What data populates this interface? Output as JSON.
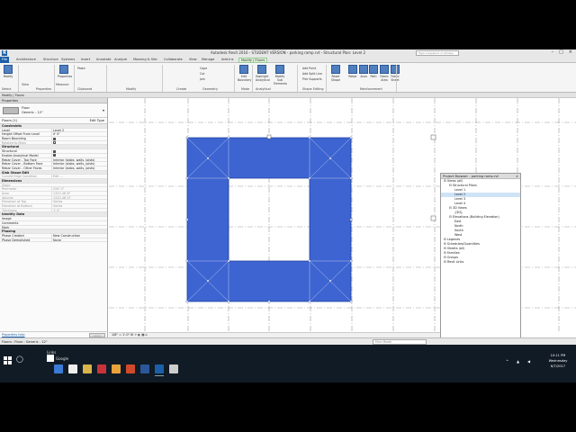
{
  "app": {
    "title": "Autodesk Revit 2016 - STUDENT VERSION - parking ramp.rvt - Structural Plan: Level 2",
    "search_placeholder": "Type a keyword or phrase",
    "logo": "R"
  },
  "tabs": [
    "File",
    "Architecture",
    "Structure",
    "Systems",
    "Insert",
    "Annotate",
    "Analyze",
    "Massing & Site",
    "Collaborate",
    "View",
    "Manage",
    "Add-Ins",
    "Modify | Floors"
  ],
  "ribbon": {
    "buttons": [
      {
        "label": "Modify",
        "icon": "cursor-icon"
      },
      {
        "label": "Properties",
        "icon": "properties-icon"
      },
      {
        "label": "Edit Boundary",
        "icon": "edit-boundary-icon"
      },
      {
        "label": "Highlight Analytical",
        "icon": "highlight-analytical-icon"
      },
      {
        "label": "Modify Sub Elements",
        "icon": "modify-sub-elements-icon"
      },
      {
        "label": "Reset Shape",
        "icon": "reset-shape-icon"
      },
      {
        "label": "Rebar",
        "icon": "rebar-icon"
      },
      {
        "label": "Area",
        "icon": "area-icon"
      },
      {
        "label": "Path",
        "icon": "path-icon"
      },
      {
        "label": "Fabric Area",
        "icon": "fabric-area-icon"
      },
      {
        "label": "Fabric Sheet",
        "icon": "fabric-sheet-icon"
      }
    ],
    "small": [
      "Cope",
      "Cut",
      "Join",
      "Paste",
      "Add Point",
      "Add Split Line",
      "Pick Supports"
    ],
    "groups": [
      "Select",
      "Properties",
      "Clipboard",
      "Geometry",
      "Modify",
      "View",
      "Measure",
      "Create",
      "Mode",
      "Analytical",
      "Shape Editing",
      "Reinforcement"
    ]
  },
  "context_bar": "Modify | Floors",
  "properties": {
    "header": "Properties",
    "type_family": "Floor",
    "type_name": "Generic - 12\"",
    "instance_filter": "Floors (1)",
    "edit_type": "Edit Type",
    "rows": [
      {
        "k": "Constraints",
        "v": "",
        "kind": "sec"
      },
      {
        "k": "Level",
        "v": "Level 2"
      },
      {
        "k": "Height Offset From Level",
        "v": "0' 0\""
      },
      {
        "k": "Room Bounding",
        "v": "",
        "check": true
      },
      {
        "k": "Related to Mass",
        "v": "",
        "check": false,
        "gray": true
      },
      {
        "k": "Structural",
        "v": "",
        "kind": "sec"
      },
      {
        "k": "Structural",
        "v": "",
        "check": true
      },
      {
        "k": "Enable Analytical Model",
        "v": "",
        "check": true
      },
      {
        "k": "Rebar Cover - Top Face",
        "v": "Interior (slabs, walls, joists)"
      },
      {
        "k": "Rebar Cover - Bottom Face",
        "v": "Interior (slabs, walls, joists)"
      },
      {
        "k": "Rebar Cover - Other Faces",
        "v": "Interior (slabs, walls, joists)"
      },
      {
        "k": "Slab Shape Edit",
        "v": "",
        "kind": "sec"
      },
      {
        "k": "Curved Edge Condition",
        "v": "Edit ...",
        "gray": true
      },
      {
        "k": "Dimensions",
        "v": "",
        "kind": "sec"
      },
      {
        "k": "Slope",
        "v": "",
        "gray": true
      },
      {
        "k": "Perimeter",
        "v": "256' 0\"",
        "gray": true
      },
      {
        "k": "Area",
        "v": "1320.48 SF",
        "gray": true
      },
      {
        "k": "Volume",
        "v": "1320.48 CF",
        "gray": true
      },
      {
        "k": "Elevation at Top",
        "v": "Varies",
        "gray": true
      },
      {
        "k": "Elevation at Bottom",
        "v": "Varies",
        "gray": true
      },
      {
        "k": "Thickness",
        "v": "1' 0\"",
        "gray": true
      },
      {
        "k": "Identity Data",
        "v": "",
        "kind": "sec"
      },
      {
        "k": "Image",
        "v": ""
      },
      {
        "k": "Comments",
        "v": ""
      },
      {
        "k": "Mark",
        "v": ""
      },
      {
        "k": "Phasing",
        "v": "",
        "kind": "sec"
      },
      {
        "k": "Phase Created",
        "v": "New Construction"
      },
      {
        "k": "Phase Demolished",
        "v": "None"
      }
    ],
    "help_link": "Properties help",
    "apply": "Apply"
  },
  "browser": {
    "title": "Project Browser - parking ramp.rvt",
    "items": [
      {
        "label": "Views (all)",
        "indent": 0
      },
      {
        "label": "Structural Plans",
        "indent": 1
      },
      {
        "label": "Level 1",
        "indent": 2
      },
      {
        "label": "Level 2",
        "indent": 2,
        "selected": true
      },
      {
        "label": "Level 3",
        "indent": 2
      },
      {
        "label": "Level 4",
        "indent": 2
      },
      {
        "label": "3D Views",
        "indent": 1
      },
      {
        "label": "{3D}",
        "indent": 2
      },
      {
        "label": "Elevations (Building Elevation)",
        "indent": 1
      },
      {
        "label": "East",
        "indent": 2
      },
      {
        "label": "North",
        "indent": 2
      },
      {
        "label": "South",
        "indent": 2
      },
      {
        "label": "West",
        "indent": 2
      },
      {
        "label": "Legends",
        "indent": 0
      },
      {
        "label": "Schedules/Quantities",
        "indent": 0
      },
      {
        "label": "Sheets (all)",
        "indent": 0
      },
      {
        "label": "Families",
        "indent": 0
      },
      {
        "label": "Groups",
        "indent": 0
      },
      {
        "label": "Revit Links",
        "indent": 0
      }
    ]
  },
  "view_control": "1/8\" = 1'-0\"",
  "status": {
    "text": "Floors : Floor : Generic - 12\"",
    "main_model": "Main Model"
  },
  "taskbar": {
    "tooltip": [
      "Links",
      "Google"
    ],
    "time": "10:11 PM",
    "day": "Wednesday",
    "date": "6/7/2017",
    "apps": [
      {
        "name": "edge-icon",
        "color": "#3a7bd5"
      },
      {
        "name": "store-icon",
        "color": "#eeeeee"
      },
      {
        "name": "files-icon",
        "color": "#d9b44a"
      },
      {
        "name": "revit-t-icon",
        "color": "#c8333a"
      },
      {
        "name": "chrome-icon",
        "color": "#e9a23b"
      },
      {
        "name": "office-icon",
        "color": "#d04a2a"
      },
      {
        "name": "word-icon",
        "color": "#2b579a"
      },
      {
        "name": "revit-icon",
        "color": "#1c5fa8"
      },
      {
        "name": "explorer-icon",
        "color": "#cccccc"
      }
    ]
  },
  "colors": {
    "floor": "#3d64d1",
    "floor_edge": "#1d3f9e",
    "grid": "#888888",
    "accent": "#1c5fa8"
  }
}
